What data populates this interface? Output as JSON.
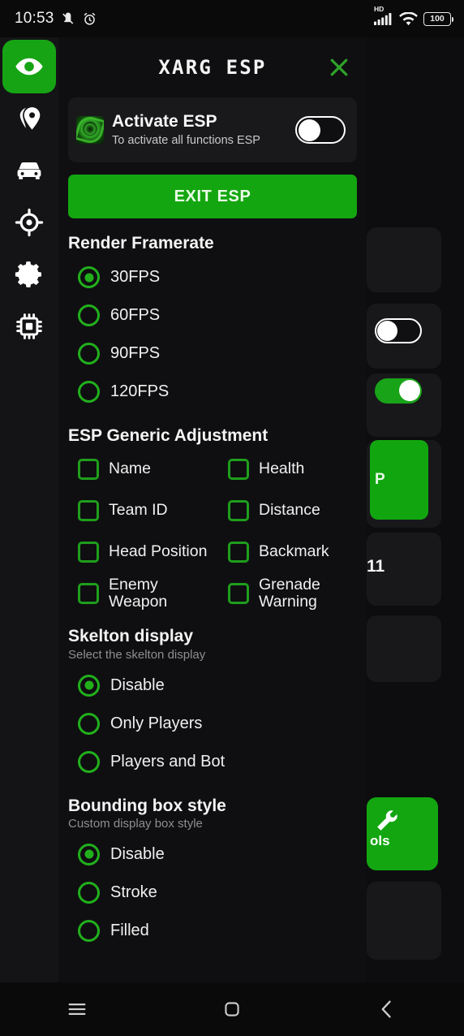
{
  "status_bar": {
    "time": "10:53",
    "icons_left": [
      "mute-icon",
      "alarm-icon"
    ],
    "network_tag": "HD",
    "icons_right": [
      "signal-icon",
      "wifi-icon"
    ],
    "battery_level": "100"
  },
  "sidebar": {
    "items": [
      {
        "name": "eye-icon",
        "label": "ESP",
        "active": true
      },
      {
        "name": "location-pin-icon",
        "label": "Location",
        "active": false
      },
      {
        "name": "car-icon",
        "label": "Vehicle",
        "active": false
      },
      {
        "name": "target-icon",
        "label": "Aim",
        "active": false
      },
      {
        "name": "gear-icon",
        "label": "Settings",
        "active": false
      },
      {
        "name": "chip-icon",
        "label": "Memory",
        "active": false
      }
    ]
  },
  "panel": {
    "title": "XARG ESP",
    "close_icon": "close-icon",
    "activate_card": {
      "icon": "app-logo-emblem",
      "title": "Activate ESP",
      "subtitle": "To activate all functions ESP",
      "toggle_state": "off"
    },
    "exit_button": "EXIT ESP",
    "sections": [
      {
        "id": "render-framerate",
        "title": "Render Framerate",
        "subtitle": "",
        "type": "radio",
        "options": [
          {
            "label": "30FPS",
            "selected": true
          },
          {
            "label": "60FPS",
            "selected": false
          },
          {
            "label": "90FPS",
            "selected": false
          },
          {
            "label": "120FPS",
            "selected": false
          }
        ]
      },
      {
        "id": "esp-generic-adjustment",
        "title": "ESP Generic Adjustment",
        "subtitle": "",
        "type": "checkbox-grid",
        "options": [
          {
            "label": "Name",
            "checked": false
          },
          {
            "label": "Health",
            "checked": false
          },
          {
            "label": "Team ID",
            "checked": false
          },
          {
            "label": "Distance",
            "checked": false
          },
          {
            "label": "Head Position",
            "checked": false
          },
          {
            "label": "Backmark",
            "checked": false
          },
          {
            "label": "Enemy Weapon",
            "checked": false
          },
          {
            "label": "Grenade Warning",
            "checked": false
          }
        ]
      },
      {
        "id": "skelton-display",
        "title": "Skelton display",
        "subtitle": "Select the skelton display",
        "type": "radio",
        "options": [
          {
            "label": "Disable",
            "selected": true
          },
          {
            "label": "Only Players",
            "selected": false
          },
          {
            "label": "Players and Bot",
            "selected": false
          }
        ]
      },
      {
        "id": "bounding-box-style",
        "title": "Bounding box style",
        "subtitle": "Custom display box style",
        "type": "radio",
        "options": [
          {
            "label": "Disable",
            "selected": true
          },
          {
            "label": "Stroke",
            "selected": false
          },
          {
            "label": "Filled",
            "selected": false
          }
        ]
      }
    ]
  },
  "background_app": {
    "partial_button_label": "P",
    "partial_text": "11",
    "partial_tool_label": "ols",
    "toggles": [
      {
        "state": "off"
      },
      {
        "state": "on"
      }
    ]
  },
  "nav_bar": {
    "recents_icon": "menu-icon",
    "home_icon": "home-square-icon",
    "back_icon": "back-chevron-icon"
  },
  "colors": {
    "accent_green": "#14a610",
    "radio_green": "#21b01c",
    "panel_bg": "#0f0f11",
    "card_bg": "#19191c",
    "sidebar_bg": "#141416",
    "text_primary": "#f4f4f4",
    "text_secondary": "#8e8e8e"
  }
}
